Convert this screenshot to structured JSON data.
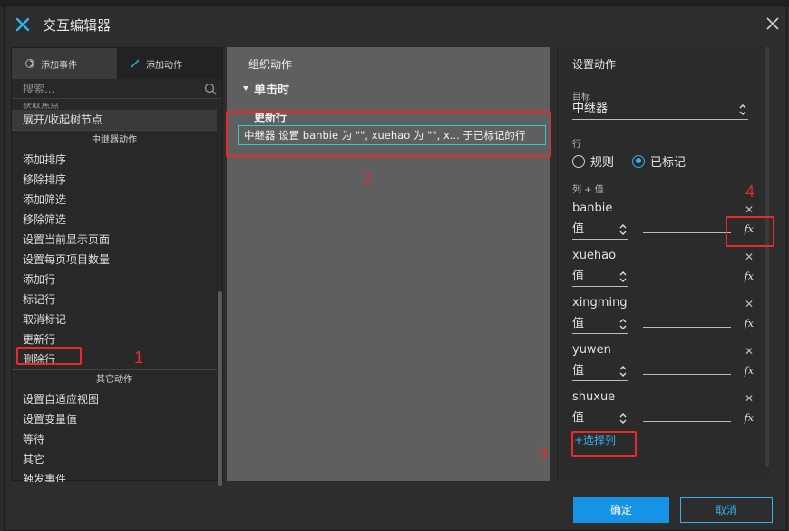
{
  "window": {
    "title": "交互编辑器"
  },
  "left_panel": {
    "tabs": [
      {
        "label": "添加事件"
      },
      {
        "label": "添加动作"
      }
    ],
    "search": {
      "placeholder": "搜索..."
    },
    "items_top": [
      {
        "label": "获取焦点",
        "partial": true
      },
      {
        "label": "展开/收起树节点"
      }
    ],
    "section_repeater": "中继器动作",
    "repeater_items": [
      {
        "label": "添加排序"
      },
      {
        "label": "移除排序"
      },
      {
        "label": "添加筛选"
      },
      {
        "label": "移除筛选"
      },
      {
        "label": "设置当前显示页面"
      },
      {
        "label": "设置每页项目数量"
      },
      {
        "label": "添加行"
      },
      {
        "label": "标记行"
      },
      {
        "label": "取消标记"
      },
      {
        "label": "更新行"
      },
      {
        "label": "删除行"
      }
    ],
    "section_other": "其它动作",
    "other_items": [
      {
        "label": "设置自适应视图"
      },
      {
        "label": "设置变量值"
      },
      {
        "label": "等待"
      },
      {
        "label": "其它"
      },
      {
        "label": "触发事件"
      }
    ]
  },
  "middle_panel": {
    "header": "组织动作",
    "case_label": "单击时",
    "action_title": "更新行",
    "action_item": "中继器 设置 banbie 为 \"\", xuehao 为 \"\", x... 于已标记的行"
  },
  "right_panel": {
    "header": "设置动作",
    "target_label": "目标",
    "target_value": "中继器",
    "row_label": "行",
    "row_options": [
      {
        "label": "规则",
        "selected": false
      },
      {
        "label": "已标记",
        "selected": true
      }
    ],
    "columns_label": "列 + 值",
    "columns": [
      {
        "name": "banbie",
        "type": "值",
        "fx": "fx"
      },
      {
        "name": "xuehao",
        "type": "值",
        "fx": "fx"
      },
      {
        "name": "xingming",
        "type": "值",
        "fx": "fx"
      },
      {
        "name": "yuwen",
        "type": "值",
        "fx": "fx"
      },
      {
        "name": "shuxue",
        "type": "值",
        "fx": "fx"
      }
    ],
    "add_column": "+选择列"
  },
  "buttons": {
    "ok": "确定",
    "cancel": "取消"
  },
  "annotations": [
    "1",
    "2",
    "3",
    "4"
  ],
  "colors": {
    "accent": "#35b0f0",
    "annotation_red": "#e52b2b",
    "selection_cyan": "#37c9c9"
  }
}
